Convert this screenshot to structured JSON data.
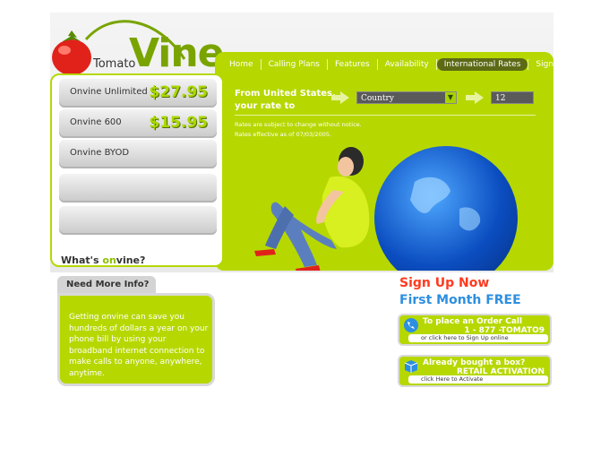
{
  "logo": {
    "small": "Tomato",
    "big": "Vine"
  },
  "nav": [
    "Home",
    "Calling Plans",
    "Features",
    "Availability",
    "International Rates",
    "Sign Up"
  ],
  "rates": {
    "label": "From United States,\nyour rate to",
    "country_value": "Country",
    "rate_value": "12",
    "note1": "Rates are subject to change without notice.",
    "note2": "Rates effective as of 07/03/2005."
  },
  "plans": [
    {
      "name": "Onvine Unlimited",
      "price": "$27.95"
    },
    {
      "name": "Onvine 600",
      "price": "$15.95"
    },
    {
      "name": "Onvine BYOD",
      "price": ""
    }
  ],
  "whats": {
    "prefix": "What's ",
    "on": "on",
    "suffix": "vine?"
  },
  "info": {
    "tab": "Need More Info?",
    "text": "Getting onvine can save you hundreds of dollars a year on your phone bill by using your broadband internet connection to make calls to anyone, anywhere, anytime."
  },
  "promo": {
    "signup": "Sign Up Now",
    "first_month": "First Month FREE"
  },
  "order": {
    "title": "To place an Order Call",
    "phone": "1 - 877 -TOMATO9",
    "link": "or click here to Sign Up online"
  },
  "retail": {
    "title": "Already bought a box?",
    "subtitle": "RETAIL ACTIVATION",
    "link": "click Here to Activate"
  },
  "colors": {
    "brand_green": "#b6d800",
    "signup_red": "#ff3a1f",
    "free_blue": "#2d8fe0"
  }
}
